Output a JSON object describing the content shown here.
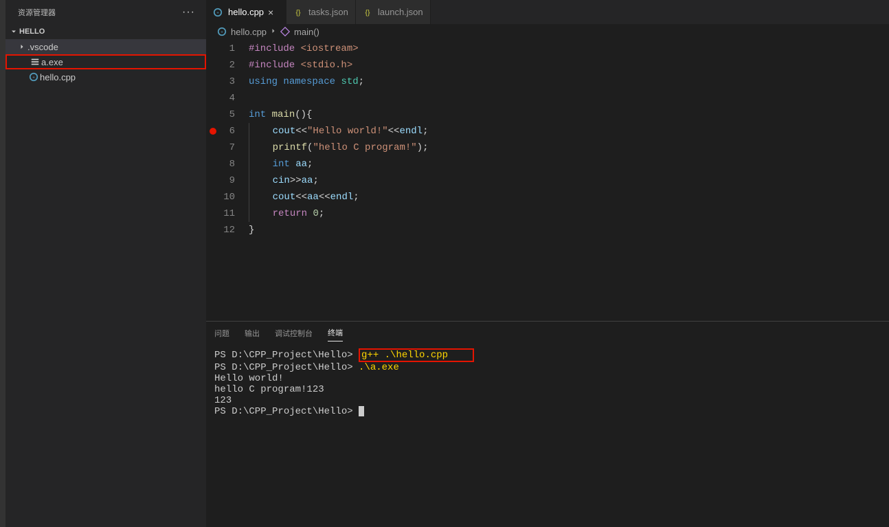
{
  "sidebar": {
    "title": "资源管理器",
    "section": "HELLO",
    "items": [
      {
        "label": ".vscode",
        "type": "folder"
      },
      {
        "label": "a.exe",
        "type": "exe"
      },
      {
        "label": "hello.cpp",
        "type": "cpp"
      }
    ]
  },
  "tabs": [
    {
      "label": "hello.cpp",
      "icon": "cpp",
      "active": true
    },
    {
      "label": "tasks.json",
      "icon": "json",
      "active": false
    },
    {
      "label": "launch.json",
      "icon": "json",
      "active": false
    }
  ],
  "breadcrumb": {
    "file": "hello.cpp",
    "symbol": "main()"
  },
  "code": {
    "line_numbers": [
      "1",
      "2",
      "3",
      "4",
      "5",
      "6",
      "7",
      "8",
      "9",
      "10",
      "11",
      "12"
    ],
    "breakpoint_line": 6,
    "lines": {
      "l1": {
        "include": "#include",
        "target": "<iostream>"
      },
      "l2": {
        "include": "#include",
        "target": "<stdio.h>"
      },
      "l3": {
        "using": "using",
        "namespace_kw": "namespace",
        "ns": "std",
        "semi": ";"
      },
      "l5": {
        "ret_type": "int",
        "fn": "main",
        "paren": "(){",
        "close": ""
      },
      "l6": {
        "cout": "cout",
        "op1": "<<",
        "str": "\"Hello world!\"",
        "op2": "<<",
        "endl": "endl",
        "semi": ";"
      },
      "l7": {
        "fn": "printf",
        "open": "(",
        "str": "\"hello C program!\"",
        "close": ")",
        "semi": ";"
      },
      "l8": {
        "type": "int",
        "var": "aa",
        "semi": ";"
      },
      "l9": {
        "cin": "cin",
        "op": ">>",
        "var": "aa",
        "semi": ";"
      },
      "l10": {
        "cout": "cout",
        "op1": "<<",
        "var": "aa",
        "op2": "<<",
        "endl": "endl",
        "semi": ";"
      },
      "l11": {
        "ret": "return",
        "val": "0",
        "semi": ";"
      },
      "l12": {
        "brace": "}"
      }
    }
  },
  "panel": {
    "tabs": {
      "problems": "问题",
      "output": "输出",
      "debug": "调试控制台",
      "terminal": "终端"
    },
    "terminal": {
      "prompt1_path": "PS D:\\CPP_Project\\Hello>",
      "cmd1": "g++ .\\hello.cpp",
      "prompt2_path": "PS D:\\CPP_Project\\Hello>",
      "cmd2": ".\\a.exe",
      "out1": "Hello world!",
      "out2": "hello C program!123",
      "out3": "123",
      "prompt3_path": "PS D:\\CPP_Project\\Hello>"
    }
  }
}
